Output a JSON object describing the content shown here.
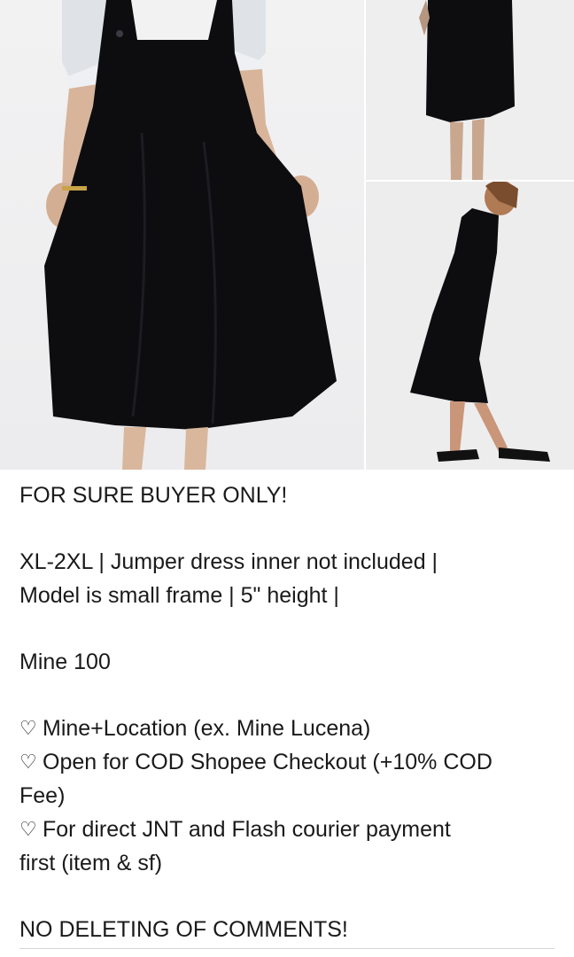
{
  "listing": {
    "photos": [
      {
        "name": "main-photo",
        "subject": "black jumper dress front view"
      },
      {
        "name": "side-photo-top",
        "subject": "black jumper dress hem"
      },
      {
        "name": "side-photo-bottom",
        "subject": "black jumper dress side view with sandals"
      }
    ],
    "description": {
      "line1": "FOR SURE BUYER ONLY!",
      "line2": "XL-2XL | Jumper dress inner not included |",
      "line3": "Model is small frame | 5\" height |",
      "line4": "Mine 100",
      "bullet1": "Mine+Location (ex. Mine Lucena)",
      "bullet2a": "Open for COD Shopee Checkout (+10% COD",
      "bullet2b": "Fee)",
      "bullet3a": "For direct JNT and Flash courier payment",
      "bullet3b": "first (item & sf)",
      "line5": "NO DELETING OF COMMENTS!",
      "bullet_symbol": "♡"
    },
    "colors": {
      "text": "#1a1a1a",
      "dress": "#0d0d10",
      "background": "#ffffff"
    }
  }
}
